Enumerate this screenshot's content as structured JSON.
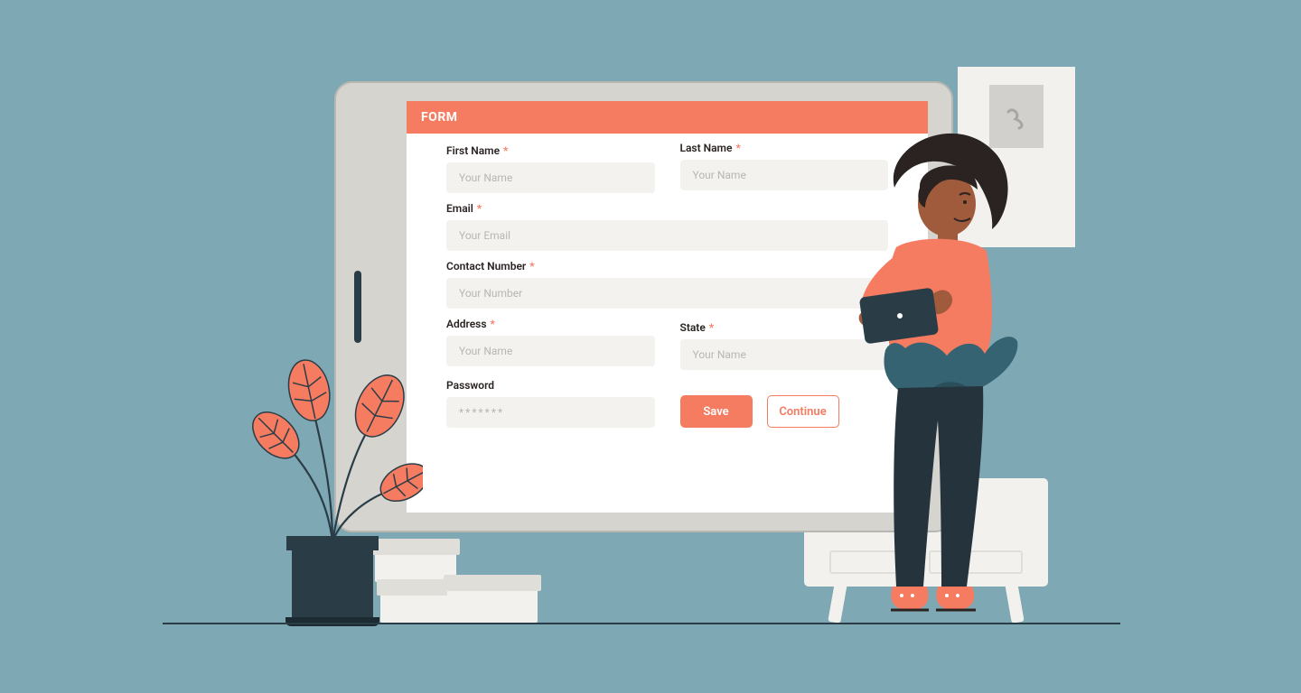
{
  "header": {
    "title": "FORM"
  },
  "fields": {
    "first_name": {
      "label": "First Name",
      "placeholder": "Your Name"
    },
    "last_name": {
      "label": "Last Name",
      "placeholder": "Your Name"
    },
    "email": {
      "label": "Email",
      "placeholder": "Your Email"
    },
    "contact": {
      "label": "Contact  Number",
      "placeholder": "Your Number"
    },
    "address": {
      "label": "Address",
      "placeholder": "Your Name"
    },
    "state": {
      "label": "State",
      "placeholder": "Your Name"
    },
    "password": {
      "label": "Password",
      "placeholder": "*******"
    }
  },
  "buttons": {
    "save": "Save",
    "continue": "Continue"
  },
  "required_marker": "*"
}
